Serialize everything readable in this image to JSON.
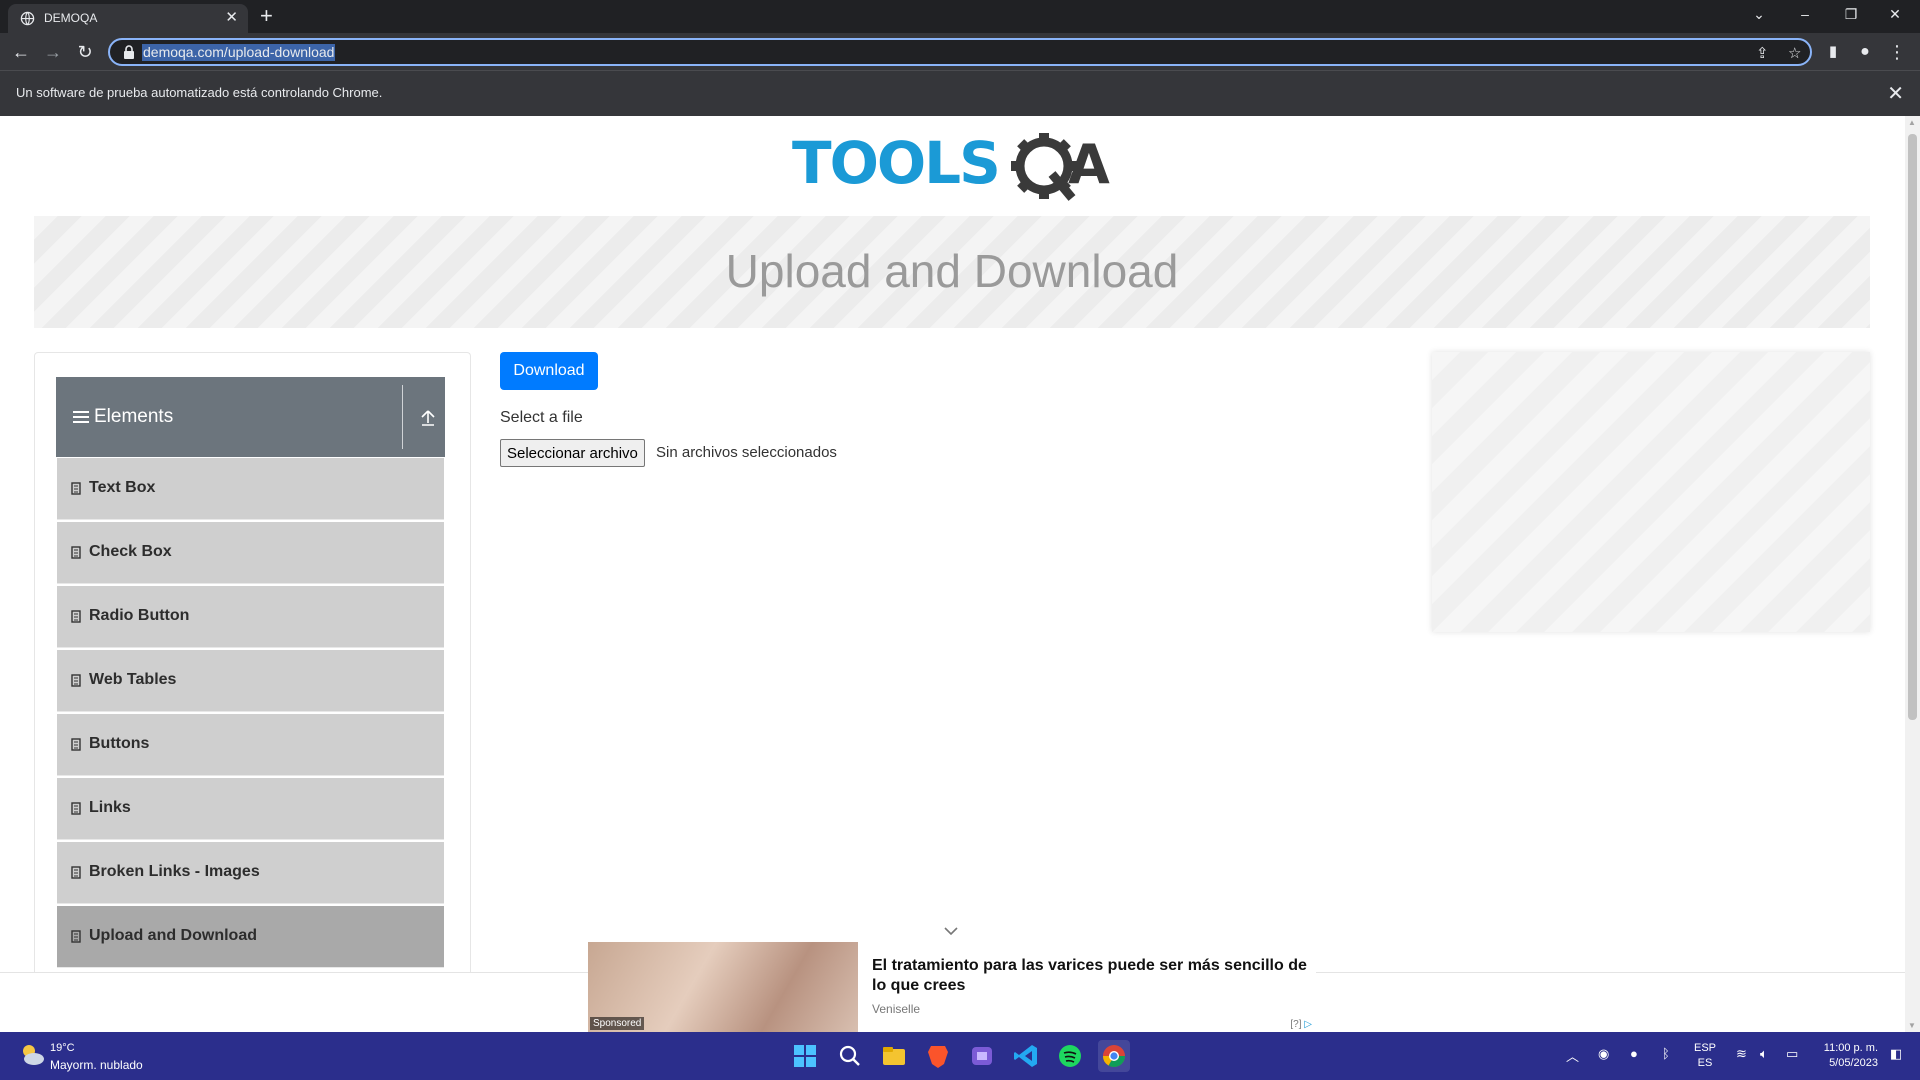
{
  "browser": {
    "tab_title": "DEMOQA",
    "url": "demoqa.com/upload-download",
    "infobar_message": "Un software de prueba automatizado está controlando Chrome."
  },
  "page": {
    "logo_alt": "TOOLSQA",
    "banner_title": "Upload and Download",
    "sidebar": {
      "group_title": "Elements",
      "items": [
        {
          "label": "Text Box"
        },
        {
          "label": "Check Box"
        },
        {
          "label": "Radio Button"
        },
        {
          "label": "Web Tables"
        },
        {
          "label": "Buttons"
        },
        {
          "label": "Links"
        },
        {
          "label": "Broken Links - Images"
        },
        {
          "label": "Upload and Download",
          "active": true
        }
      ]
    },
    "main": {
      "download_label": "Download",
      "select_label": "Select a file",
      "file_button_label": "Seleccionar archivo",
      "file_status": "Sin archivos seleccionados"
    },
    "bottom_ad": {
      "sponsored": "Sponsored",
      "headline": "El tratamiento para las varices puede ser más sencillo de lo que crees",
      "advertiser": "Veniselle",
      "adchoice": "[?]"
    }
  },
  "taskbar": {
    "weather_temp": "19°C",
    "weather_desc": "Mayorm. nublado",
    "lang_top": "ESP",
    "lang_bottom": "ES",
    "time": "11:00 p. m.",
    "date": "5/05/2023"
  },
  "colors": {
    "accent": "#007bff",
    "sidebar_header": "#6c757d",
    "taskbar": "#2b2e8c"
  }
}
